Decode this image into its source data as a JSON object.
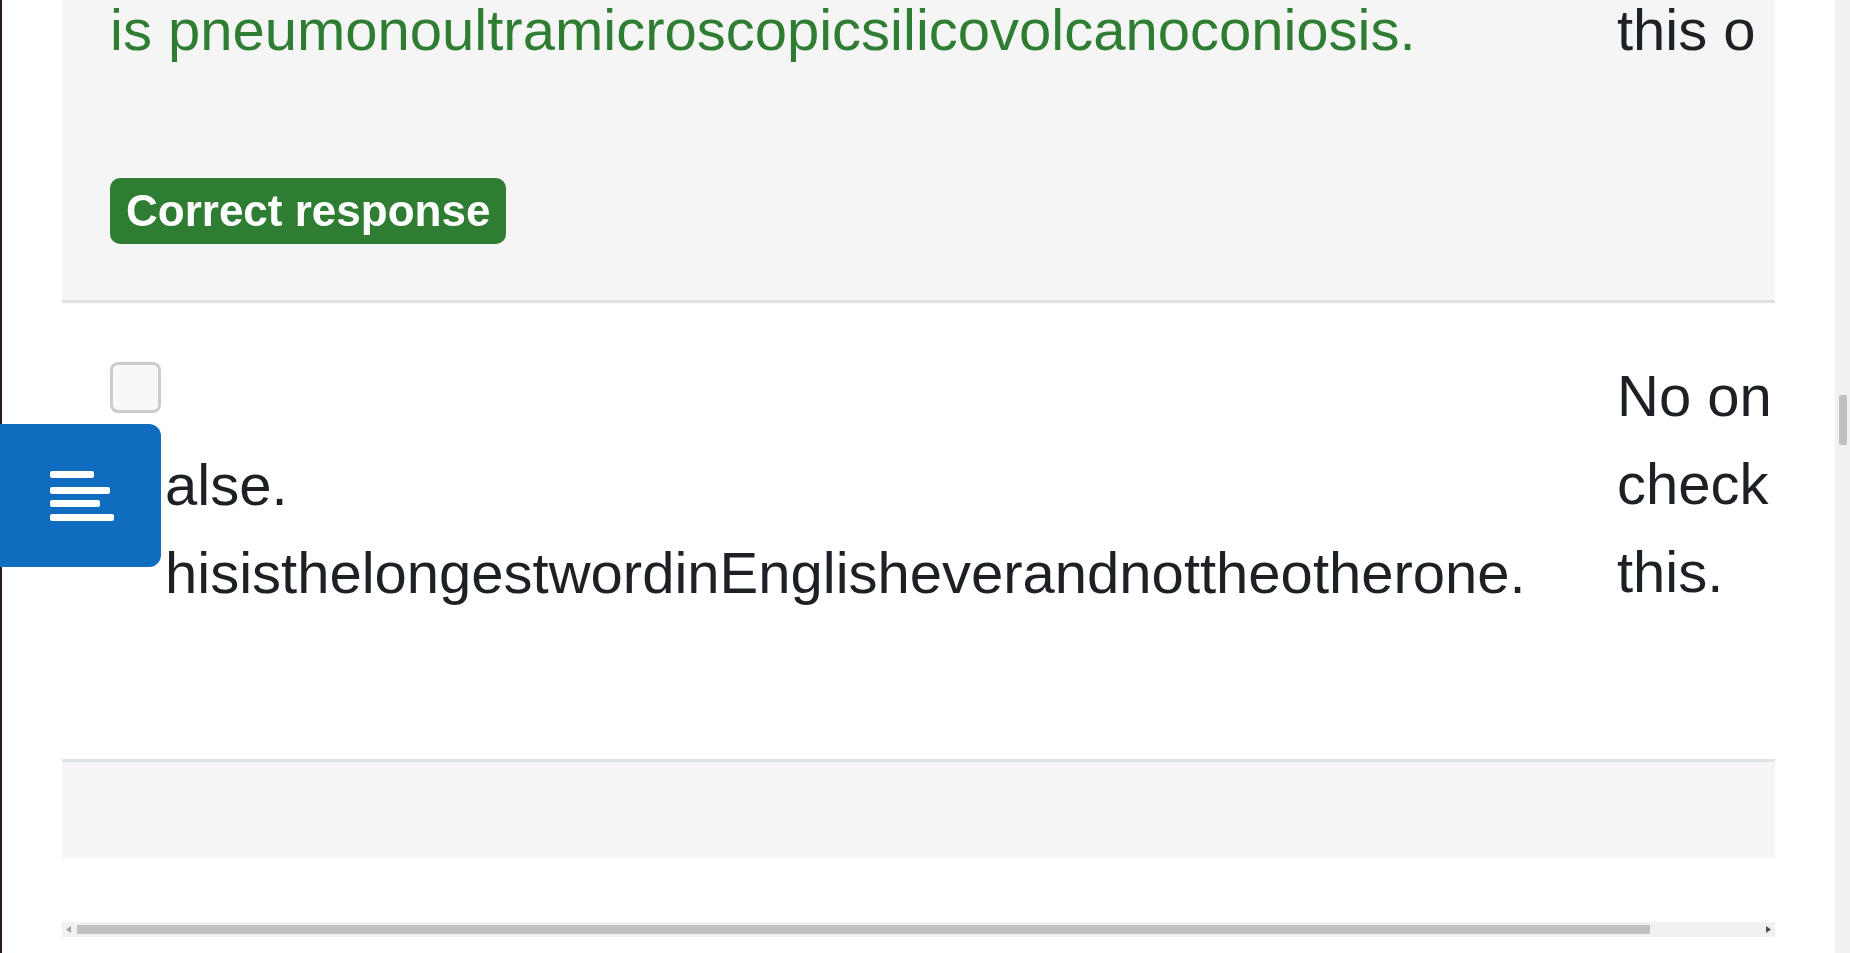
{
  "responses": [
    {
      "correct": true,
      "option_lines": [
        "is pneumonoultramicroscopicsilicovolcanoconiosis."
      ],
      "badge": "Correct response",
      "feedback_lines": [
        "this o"
      ]
    },
    {
      "correct": false,
      "checked": false,
      "option_lines": [
        "alse.",
        "hisisthelongestwordinEnglisheverandnottheotherone."
      ],
      "feedback_lines": [
        "No on",
        "check",
        "this."
      ]
    }
  ]
}
